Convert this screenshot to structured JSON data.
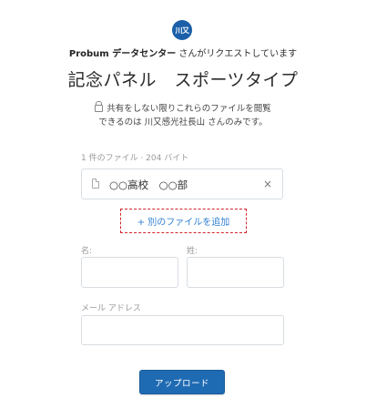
{
  "header": {
    "avatar_text": "川又",
    "avatar_color": "#1b5fa8",
    "org_name": "Probum データセンター",
    "request_text": " さんがリクエストしています",
    "title": "記念パネル　スポーツタイプ"
  },
  "privacy": {
    "icon": "lock-icon",
    "line1": "共有をしない限りこれらのファイルを閲覧",
    "line2": "できるのは 川又感光社長山 さんのみです。"
  },
  "files": {
    "summary": "1 件のファイル · 204 バイト",
    "items": [
      {
        "name": "○○高校　○○部",
        "icon": "file-icon",
        "remove_label": "×"
      }
    ],
    "add_label": "+ 別のファイルを追加"
  },
  "form": {
    "first_name_label": "名:",
    "first_name_value": "",
    "last_name_label": "姓:",
    "last_name_value": "",
    "email_label": "メール アドレス",
    "email_value": ""
  },
  "actions": {
    "upload_label": "アップロード",
    "upload_color": "#1f6bb3",
    "add_file_border_color": "#d0242a"
  }
}
